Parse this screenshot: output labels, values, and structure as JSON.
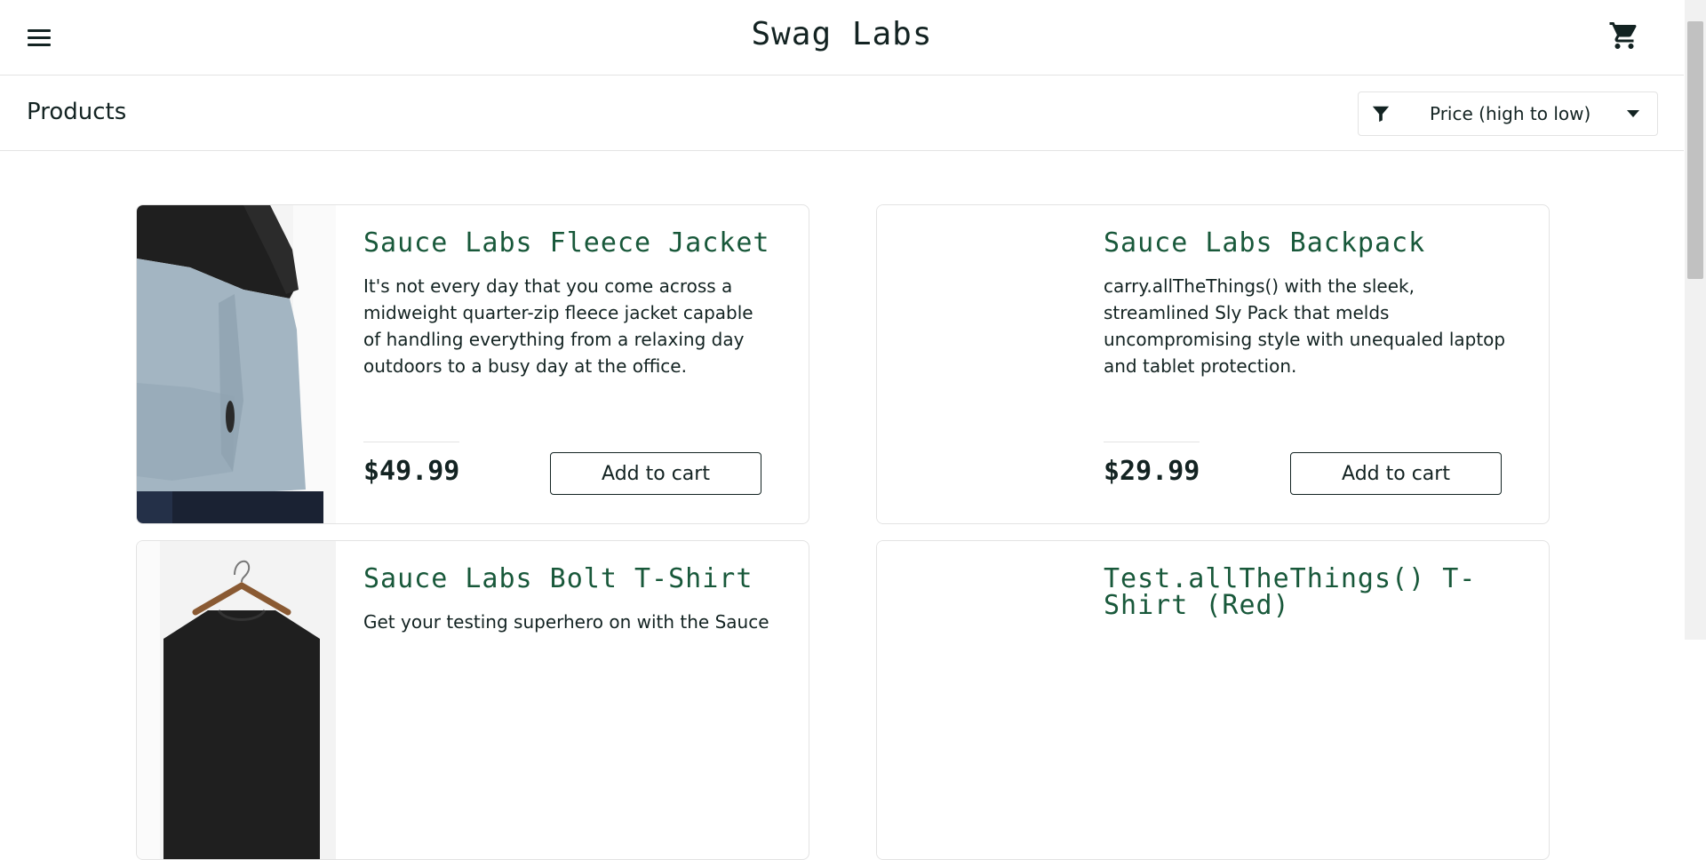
{
  "header": {
    "title": "Swag Labs"
  },
  "icons": {
    "menu": "hamburger-menu-icon",
    "cart": "shopping-cart-icon",
    "filter": "filter-funnel-icon",
    "dropdown": "caret-down-icon"
  },
  "subheader": {
    "title": "Products",
    "sort_selected": "Price (high to low)"
  },
  "colors": {
    "product_name": "#18583a",
    "text": "#132322",
    "border": "#e3e3e3"
  },
  "products": [
    {
      "name": "Sauce Labs Fleece Jacket",
      "description": "It's not every day that you come across a midweight quarter-zip fleece jacket capable of handling everything from a relaxing day outdoors to a busy day at the office.",
      "price": "$49.99",
      "button": "Add to cart"
    },
    {
      "name": "Sauce Labs Backpack",
      "description": "carry.allTheThings() with the sleek, streamlined Sly Pack that melds uncompromising style with unequaled laptop and tablet protection.",
      "price": "$29.99",
      "button": "Add to cart"
    },
    {
      "name": "Sauce Labs Bolt T-Shirt",
      "description": "Get your testing superhero on with the Sauce"
    },
    {
      "name": "Test.allTheThings() T-Shirt (Red)"
    }
  ]
}
